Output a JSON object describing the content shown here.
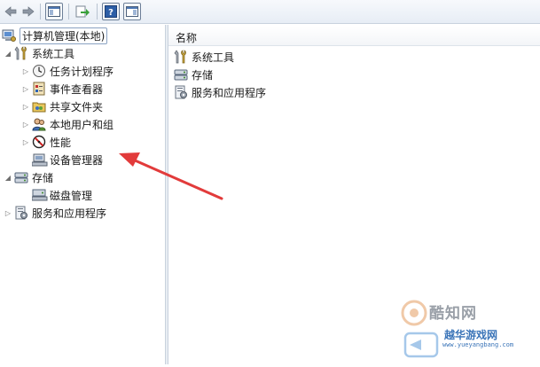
{
  "toolbar": {
    "buttons": [
      "back-arrow-icon",
      "forward-arrow-icon",
      "show-hide-tree-icon",
      "export-list-icon",
      "help-icon",
      "action-pane-icon"
    ]
  },
  "tree": {
    "root": "计算机管理(本地)",
    "system_tools": "系统工具",
    "task_scheduler": "任务计划程序",
    "event_viewer": "事件查看器",
    "shared_folders": "共享文件夹",
    "local_users": "本地用户和组",
    "performance": "性能",
    "device_manager": "设备管理器",
    "storage": "存储",
    "disk_management": "磁盘管理",
    "services_apps": "服务和应用程序"
  },
  "content": {
    "column_name": "名称",
    "items": [
      "系统工具",
      "存储",
      "服务和应用程序"
    ]
  },
  "watermark": {
    "brand1": "酷知网",
    "brand2": "越华游戏网",
    "url": "www.yueyangbang.com"
  }
}
